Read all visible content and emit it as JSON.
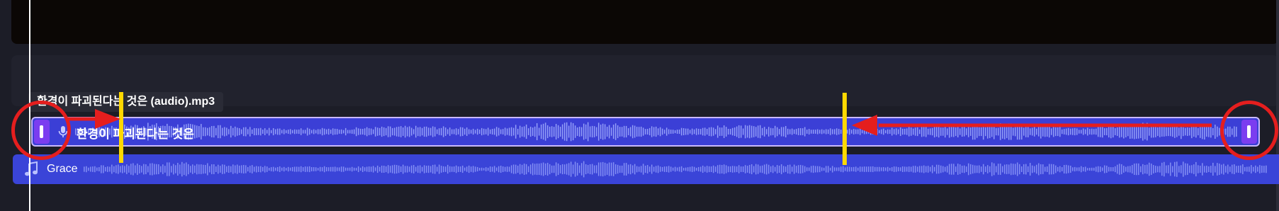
{
  "timeline": {
    "tooltip_text": "환경이 파괴된다는 것은 (audio).mp3",
    "audio_clip": {
      "label": "환경이 파괴된다는 것은",
      "icon": "microphone-icon",
      "color": "#3b3fd6",
      "handle_color": "#7b3df0"
    },
    "music_clip": {
      "label": "Grace",
      "icon": "music-note-icon",
      "color": "#3a44d8"
    }
  },
  "annotations": {
    "line_color": "#ffd800",
    "circle_color": "#e51e1e",
    "arrow_color": "#e51e1e"
  }
}
